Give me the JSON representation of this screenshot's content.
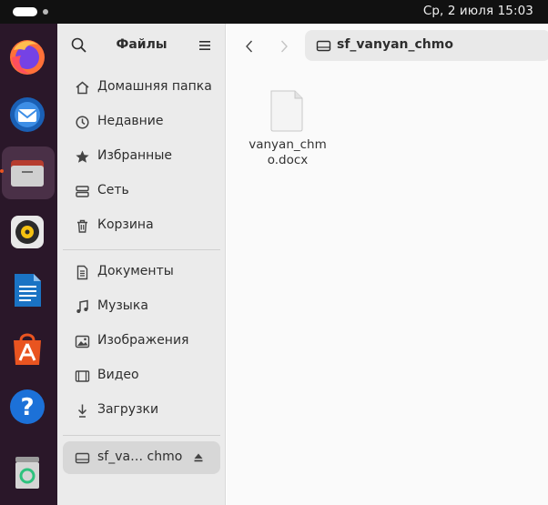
{
  "topbar": {
    "clock": "Ср, 2 июля  15:03"
  },
  "dock": {
    "items": [
      {
        "name": "Firefox",
        "icon": "firefox-icon"
      },
      {
        "name": "Thunderbird",
        "icon": "thunderbird-icon"
      },
      {
        "name": "Files",
        "icon": "files-icon",
        "active": true
      },
      {
        "name": "Rhythmbox",
        "icon": "rhythmbox-icon"
      },
      {
        "name": "LibreOffice Writer",
        "icon": "writer-icon"
      },
      {
        "name": "App Center",
        "icon": "app-center-icon"
      },
      {
        "name": "Help",
        "icon": "help-icon"
      },
      {
        "name": "Trash",
        "icon": "trash-icon"
      }
    ]
  },
  "sidebar": {
    "title": "Файлы",
    "places": [
      {
        "label": "Домашняя папка",
        "icon": "home-icon"
      },
      {
        "label": "Недавние",
        "icon": "recent-icon"
      },
      {
        "label": "Избранные",
        "icon": "star-icon"
      },
      {
        "label": "Сеть",
        "icon": "network-icon"
      },
      {
        "label": "Корзина",
        "icon": "trash-icon"
      }
    ],
    "bookmarks": [
      {
        "label": "Документы",
        "icon": "documents-icon"
      },
      {
        "label": "Музыка",
        "icon": "music-icon"
      },
      {
        "label": "Изображения",
        "icon": "pictures-icon"
      },
      {
        "label": "Видео",
        "icon": "video-icon"
      },
      {
        "label": "Загрузки",
        "icon": "downloads-icon"
      }
    ],
    "devices": [
      {
        "label": "sf_va… chmo",
        "icon": "drive-icon",
        "selected": true
      }
    ]
  },
  "pathbar": {
    "location": "sf_vanyan_chmo"
  },
  "files": [
    {
      "name": "vanyan_chmo.docx",
      "icon": "document-file-icon"
    }
  ],
  "colors": {
    "accent": "#e95420",
    "dock_bg": "#2a1729",
    "sidebar_bg": "#ebebeb"
  }
}
